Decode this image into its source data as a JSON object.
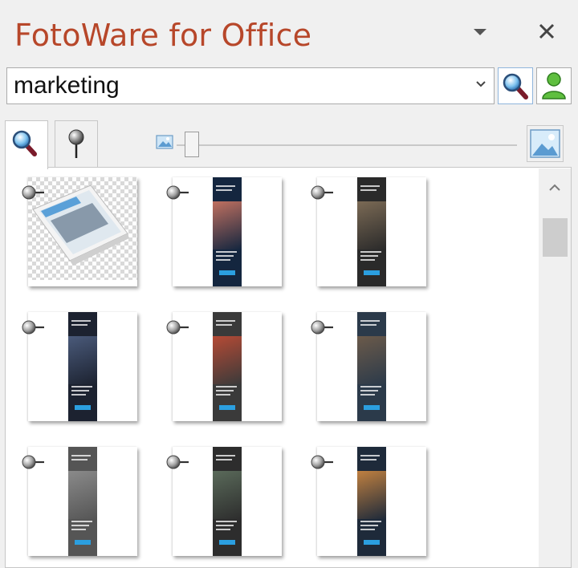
{
  "pane": {
    "title": "FotoWare for Office",
    "menu_icon": "chevron-down-icon",
    "close_icon": "close-icon"
  },
  "search": {
    "value": "marketing",
    "search_icon": "magnifier-icon",
    "user_icon": "user-icon"
  },
  "tabs": [
    {
      "name": "search-tab",
      "icon": "magnifier-icon",
      "active": true
    },
    {
      "name": "pins-tab",
      "icon": "pushpin-icon",
      "active": false
    }
  ],
  "thumbnail_size": {
    "small_icon": "small-image-icon",
    "large_icon": "large-image-icon",
    "level": 0.03
  },
  "results": [
    {
      "kind": "tablet-mockup",
      "pinned": false
    },
    {
      "kind": "banner",
      "pinned": false
    },
    {
      "kind": "banner",
      "pinned": false
    },
    {
      "kind": "banner",
      "pinned": false
    },
    {
      "kind": "banner",
      "pinned": false
    },
    {
      "kind": "banner",
      "pinned": false
    },
    {
      "kind": "banner",
      "pinned": false
    },
    {
      "kind": "banner",
      "pinned": false
    },
    {
      "kind": "banner",
      "pinned": false
    }
  ],
  "colors": {
    "title": "#b7472a",
    "accent_blue": "#2b9fe0"
  }
}
